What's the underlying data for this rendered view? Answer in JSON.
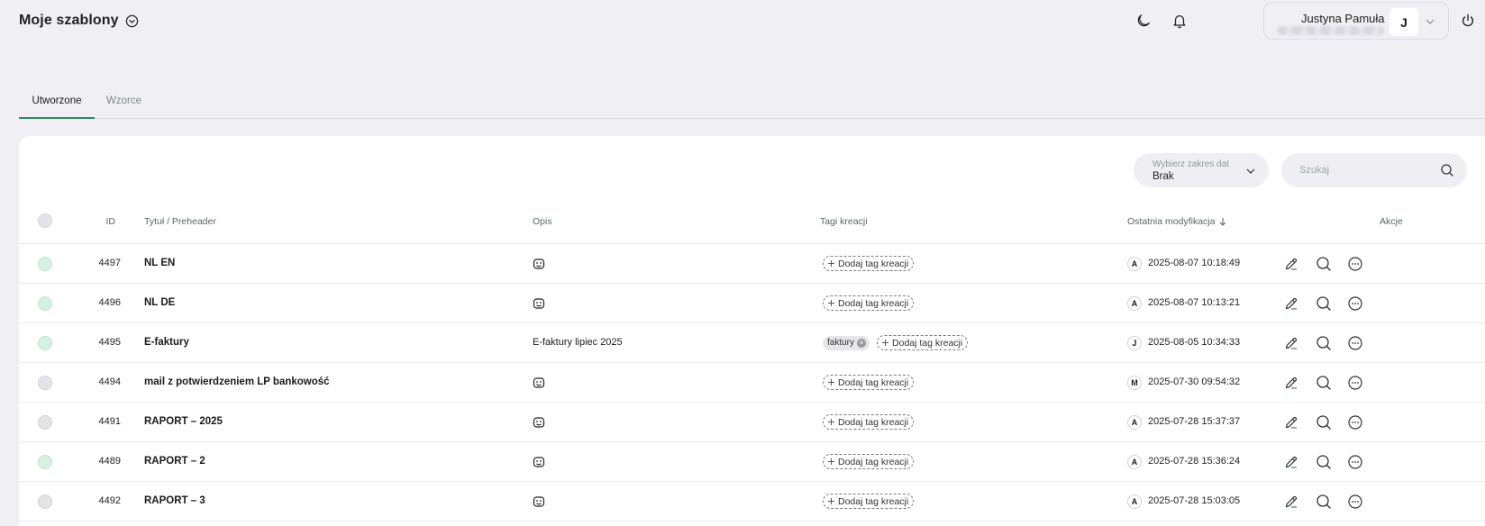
{
  "header": {
    "title": "Moje szablony",
    "user_name": "Justyna Pamuła",
    "avatar_letter": "J"
  },
  "tabs": [
    {
      "label": "Utworzone",
      "active": true
    },
    {
      "label": "Wzorce",
      "active": false
    }
  ],
  "filters": {
    "date_label": "Wybierz zakres dat",
    "date_value": "Brak",
    "search_placeholder": "Szukaj"
  },
  "columns": {
    "id": "ID",
    "title": "Tytuł / Preheader",
    "opis": "Opis",
    "tags": "Tagi kreacji",
    "modified": "Ostatnia modyfikacja",
    "actions": "Akcje"
  },
  "add_tag_label": "Dodaj tag kreacji",
  "rows": [
    {
      "id": "4497",
      "title": "NL EN",
      "opis": "",
      "tags": [],
      "avatar": "A",
      "modified": "2025-08-07 10:18:49",
      "checked_color": "green"
    },
    {
      "id": "4496",
      "title": "NL DE",
      "opis": "",
      "tags": [],
      "avatar": "A",
      "modified": "2025-08-07 10:13:21",
      "checked_color": "green"
    },
    {
      "id": "4495",
      "title": "E-faktury",
      "opis": "E-faktury lipiec 2025",
      "tags": [
        "faktury"
      ],
      "avatar": "J",
      "modified": "2025-08-05 10:34:33",
      "checked_color": "green"
    },
    {
      "id": "4494",
      "title": "mail z potwierdzeniem LP bankowość",
      "opis": "",
      "tags": [],
      "avatar": "M",
      "modified": "2025-07-30 09:54:32",
      "checked_color": "grey"
    },
    {
      "id": "4491",
      "title": "RAPORT – 2025",
      "opis": "",
      "tags": [],
      "avatar": "A",
      "modified": "2025-07-28 15:37:37",
      "checked_color": "grey"
    },
    {
      "id": "4489",
      "title": "RAPORT – 2",
      "opis": "",
      "tags": [],
      "avatar": "A",
      "modified": "2025-07-28 15:36:24",
      "checked_color": "green"
    },
    {
      "id": "4492",
      "title": "RAPORT – 3",
      "opis": "",
      "tags": [],
      "avatar": "A",
      "modified": "2025-07-28 15:03:05",
      "checked_color": "grey"
    }
  ],
  "icons": {
    "title": "chevron-circle-icon",
    "theme": "moon-icon",
    "notifications": "bell-icon",
    "power": "power-icon",
    "search": "search-icon",
    "sort": "arrow-down-icon",
    "opis": "face-icon",
    "edit": "pencil-icon",
    "preview": "magnifier-icon",
    "more": "more-icon"
  },
  "colors": {
    "accent": "#2e8b57",
    "checked": "#d4f1e1",
    "background": "#f0eff4"
  }
}
